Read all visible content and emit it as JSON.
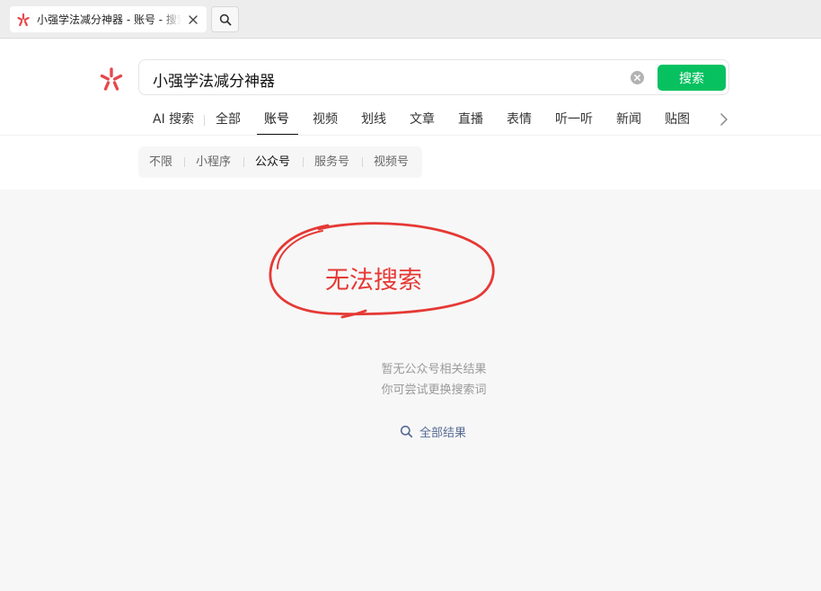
{
  "browser": {
    "tab_title": "小强学法减分神器 - 账号 - 搜索",
    "icons": {
      "favicon": "wechat-search-star-icon",
      "close": "close-icon",
      "search": "search-icon"
    }
  },
  "search": {
    "query": "小强学法减分神器",
    "button_label": "搜索",
    "icons": {
      "logo": "wechat-search-star-icon",
      "clear": "clear-circle-icon"
    }
  },
  "categories": {
    "items": [
      {
        "label": "AI 搜索"
      },
      {
        "label": "全部"
      },
      {
        "label": "账号",
        "active": true
      },
      {
        "label": "视频"
      },
      {
        "label": "划线"
      },
      {
        "label": "文章"
      },
      {
        "label": "直播"
      },
      {
        "label": "表情"
      },
      {
        "label": "听一听"
      },
      {
        "label": "新闻"
      },
      {
        "label": "贴图"
      }
    ],
    "more_icon": "chevron-right-icon"
  },
  "subfilters": {
    "items": [
      {
        "label": "不限"
      },
      {
        "label": "小程序"
      },
      {
        "label": "公众号",
        "active": true
      },
      {
        "label": "服务号"
      },
      {
        "label": "视频号"
      }
    ]
  },
  "annotation": {
    "text": "无法搜索",
    "color": "#e53935"
  },
  "empty_state": {
    "line1": "暂无公众号相关结果",
    "line2": "你可尝试更换搜索词",
    "all_results_label": "全部结果",
    "all_results_icon": "search-icon"
  },
  "colors": {
    "accent_green": "#07c160",
    "link_blue": "#576b95",
    "brand_red": "#e5494d"
  }
}
